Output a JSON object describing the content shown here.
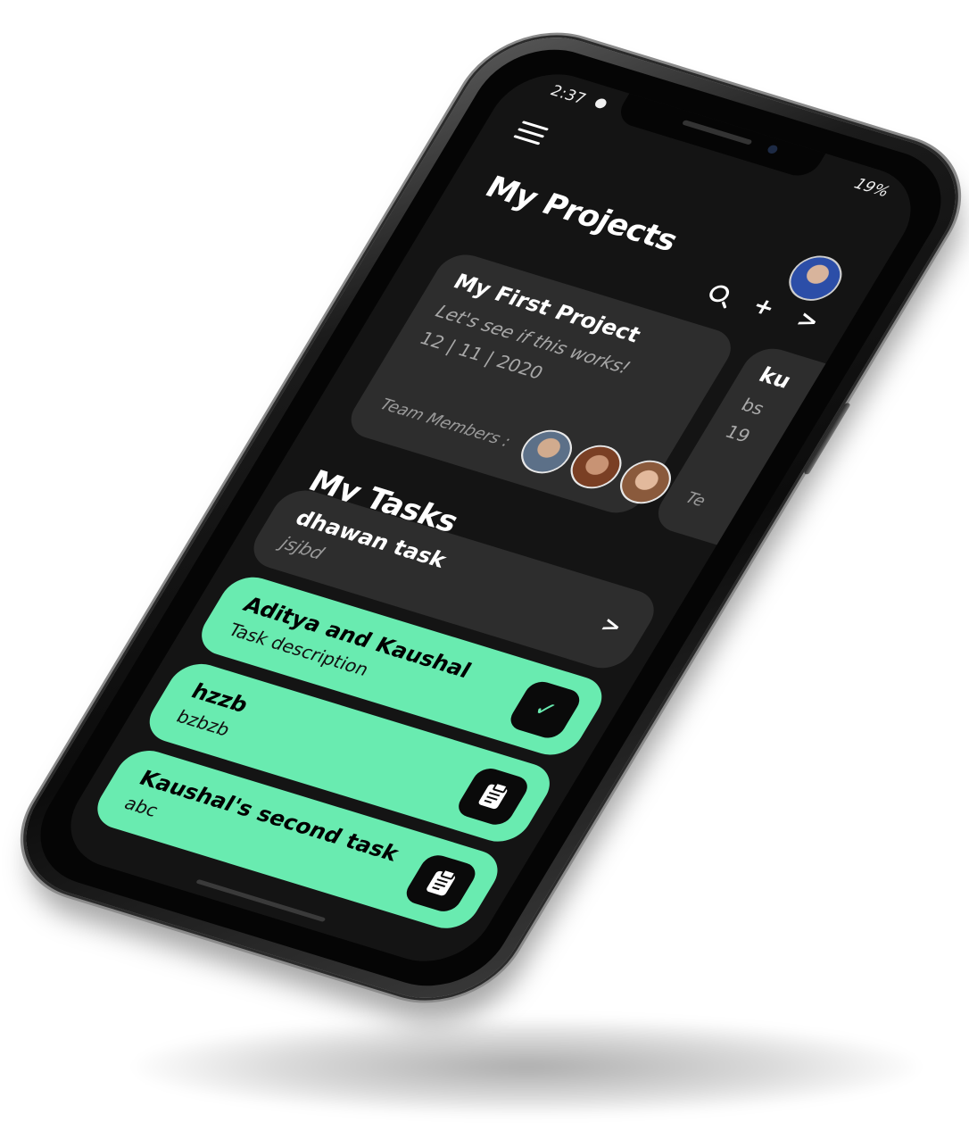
{
  "status_bar": {
    "time": "2:37",
    "battery": "19%"
  },
  "header": {
    "title": "My Projects"
  },
  "toolbar": {
    "add_label": "+",
    "next_label": ">"
  },
  "projects": [
    {
      "title": "My First Project",
      "description": "Let's see if this works!",
      "date": "12 | 11 | 2020",
      "team_label": "Team Members :"
    },
    {
      "title": "ku",
      "description": "bs",
      "date": "19",
      "team_label": "Te"
    }
  ],
  "tasks_section": {
    "title": "My Tasks"
  },
  "tasks": [
    {
      "title": "dhawan task",
      "description": "jsjbd",
      "chevron": ">",
      "style": "dark"
    },
    {
      "title": "Aditya and Kaushal",
      "description": "Task description",
      "style": "green",
      "badge_icon": "check-icon"
    },
    {
      "title": "hzzb",
      "description": "bzbzb",
      "style": "green",
      "badge_icon": "clipboard-icon"
    },
    {
      "title": "Kaushal's second task",
      "description": "abc",
      "style": "green",
      "badge_icon": "clipboard-icon"
    }
  ],
  "colors": {
    "background": "#141414",
    "card": "#2d2d2d",
    "accent_green": "#69ebb0",
    "text_primary": "#ffffff",
    "text_muted": "#a8a8a8"
  }
}
